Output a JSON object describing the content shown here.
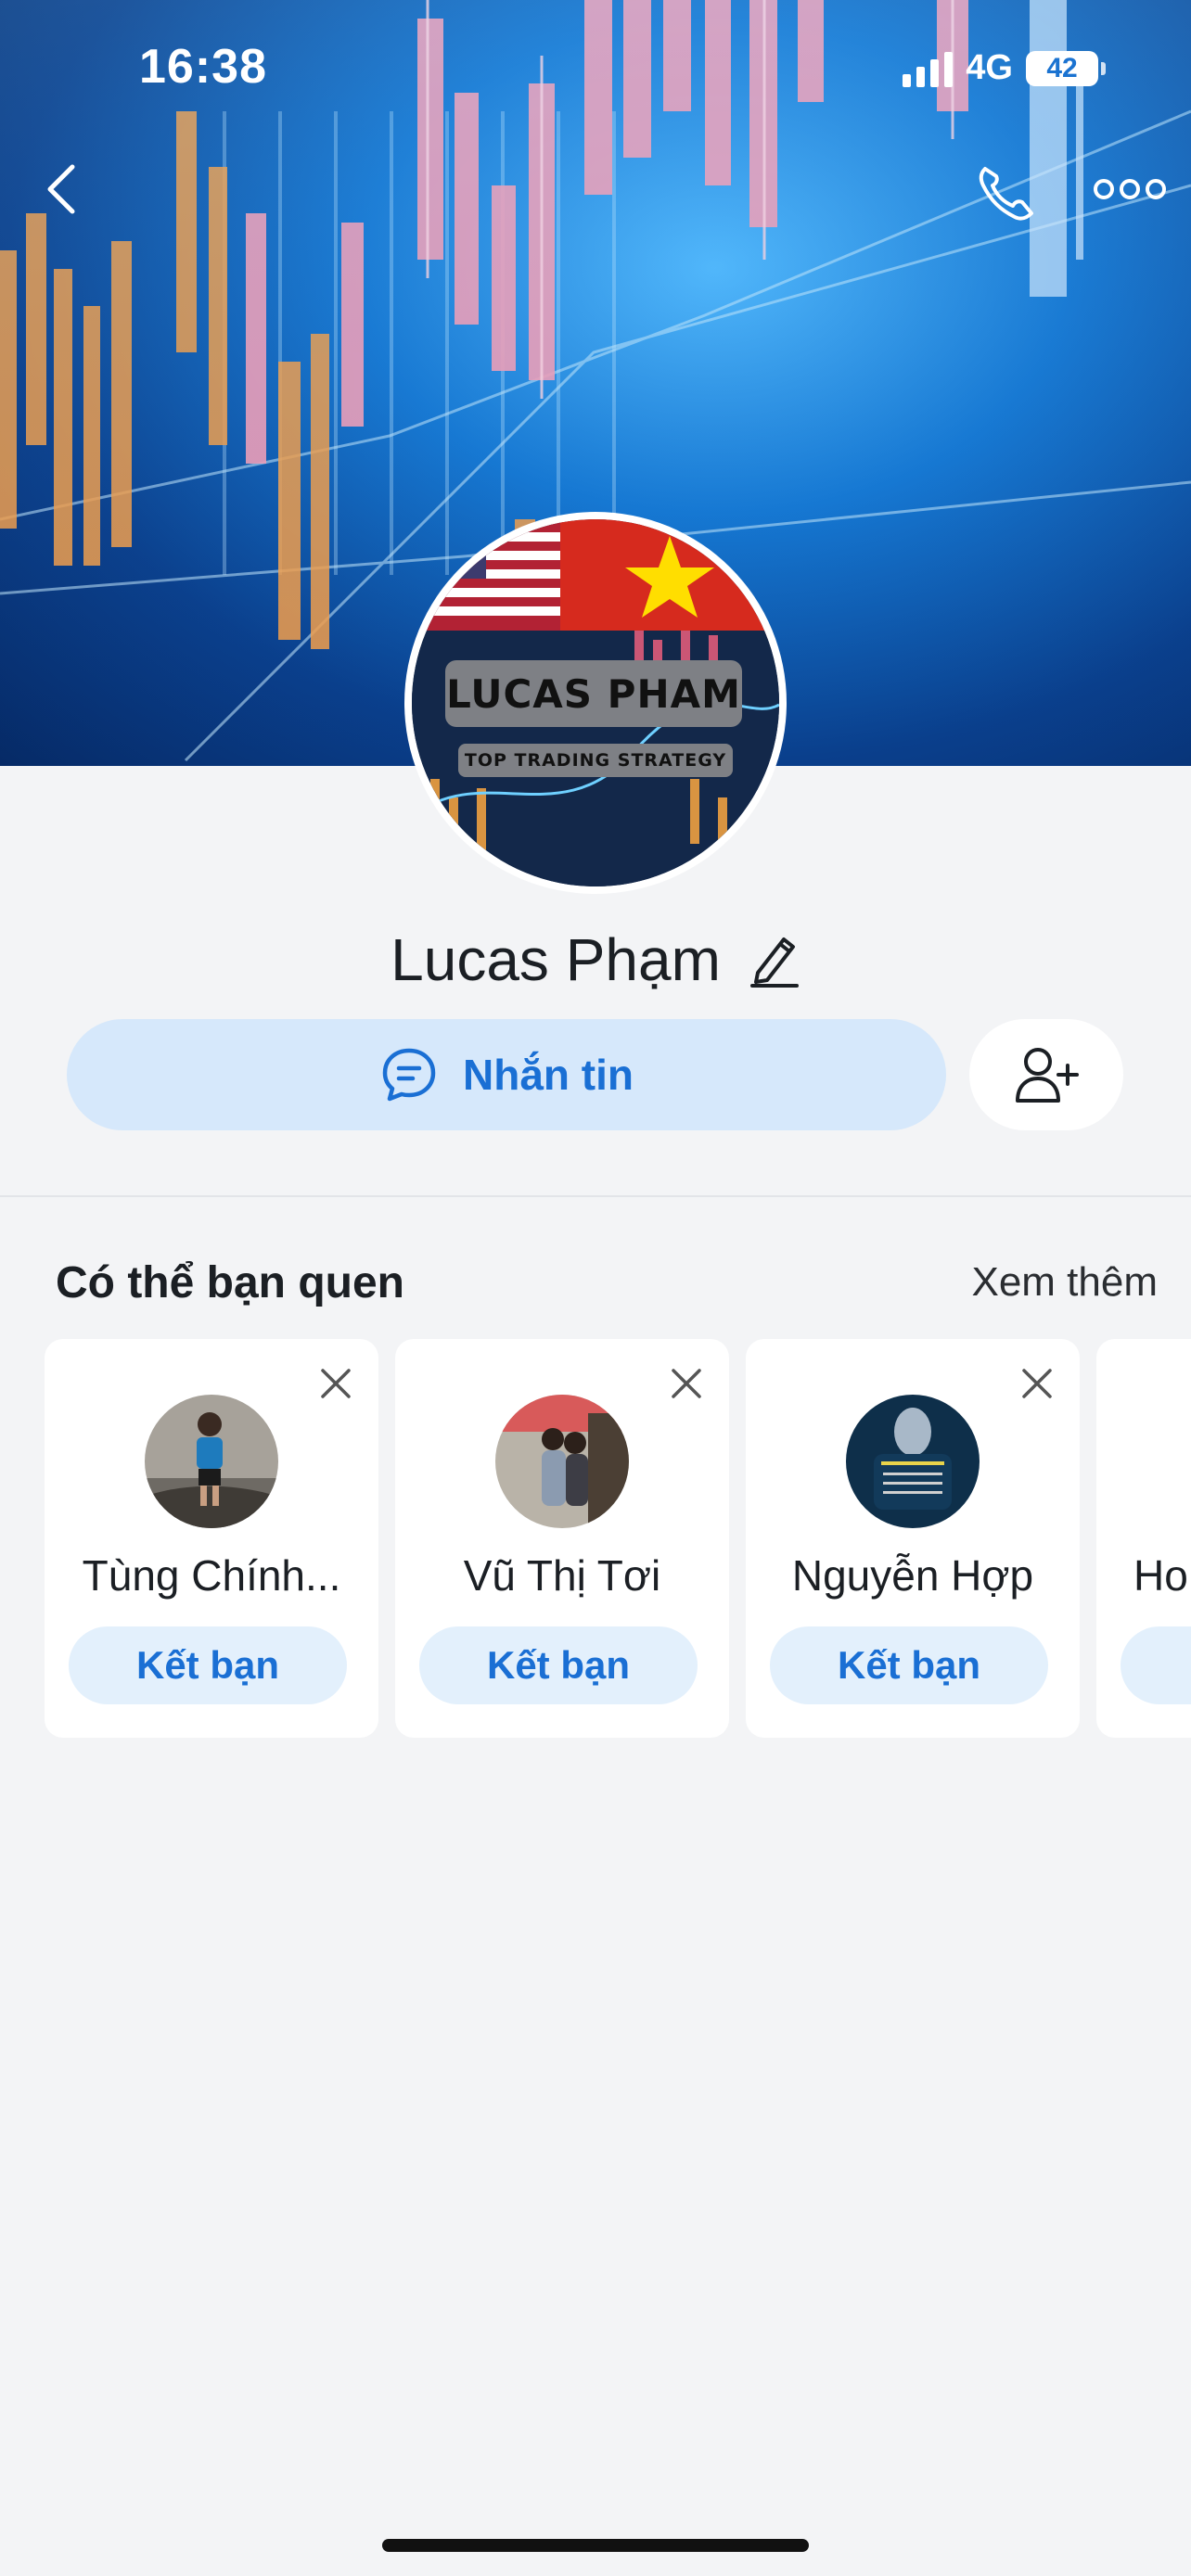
{
  "status_bar": {
    "time": "16:38",
    "network": "4G",
    "battery": "42"
  },
  "cover": {
    "icons": [
      "chevron-left-icon",
      "phone-icon",
      "more-dots-icon"
    ]
  },
  "profile": {
    "avatar_title": "LUCAS PHAM",
    "avatar_subtitle": "TOP TRADING STRATEGY",
    "name": "Lucas Phạm",
    "message_label": "Nhắn tin"
  },
  "suggestions": {
    "title": "Có thể bạn quen",
    "see_more": "Xem thêm",
    "items": [
      {
        "name": "Tùng Chính...",
        "button": "Kết bạn"
      },
      {
        "name": "Vũ Thị Tơi",
        "button": "Kết bạn"
      },
      {
        "name": "Nguyễn Hợp",
        "button": "Kết bạn"
      },
      {
        "name": "Ho",
        "button": ""
      }
    ]
  },
  "colors": {
    "accent": "#1a6fd4",
    "accent_light": "#d6e8fb",
    "background": "#f3f4f6"
  }
}
